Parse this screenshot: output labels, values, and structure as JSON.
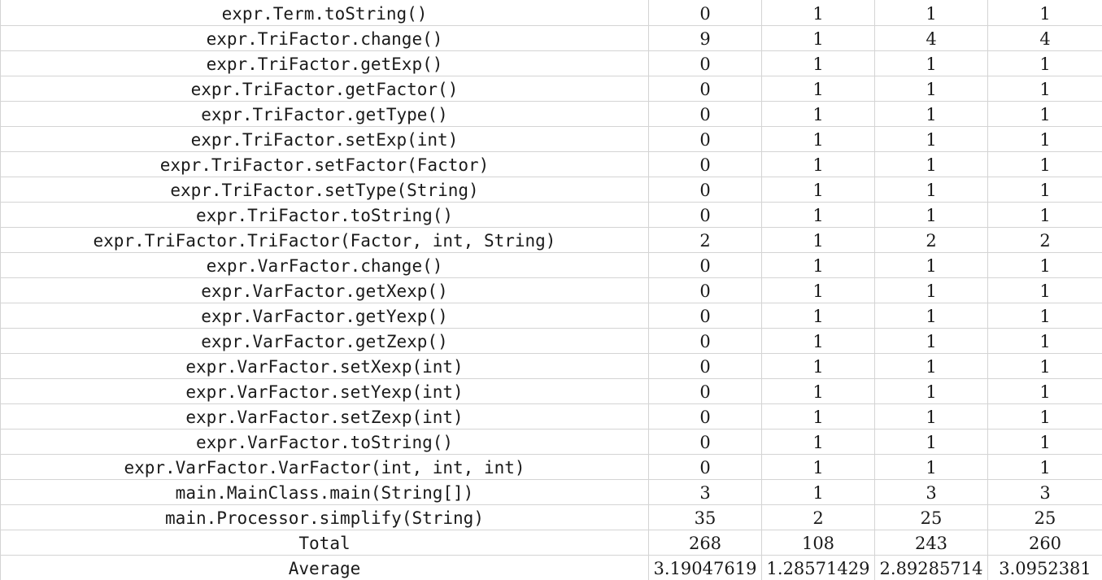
{
  "sheet": {
    "rows": [
      {
        "name": "expr.Term.toString()",
        "values": [
          "0",
          "1",
          "1",
          "1"
        ]
      },
      {
        "name": "expr.TriFactor.change()",
        "values": [
          "9",
          "1",
          "4",
          "4"
        ]
      },
      {
        "name": "expr.TriFactor.getExp()",
        "values": [
          "0",
          "1",
          "1",
          "1"
        ]
      },
      {
        "name": "expr.TriFactor.getFactor()",
        "values": [
          "0",
          "1",
          "1",
          "1"
        ]
      },
      {
        "name": "expr.TriFactor.getType()",
        "values": [
          "0",
          "1",
          "1",
          "1"
        ]
      },
      {
        "name": "expr.TriFactor.setExp(int)",
        "values": [
          "0",
          "1",
          "1",
          "1"
        ]
      },
      {
        "name": "expr.TriFactor.setFactor(Factor)",
        "values": [
          "0",
          "1",
          "1",
          "1"
        ]
      },
      {
        "name": "expr.TriFactor.setType(String)",
        "values": [
          "0",
          "1",
          "1",
          "1"
        ]
      },
      {
        "name": "expr.TriFactor.toString()",
        "values": [
          "0",
          "1",
          "1",
          "1"
        ]
      },
      {
        "name": "expr.TriFactor.TriFactor(Factor, int, String)",
        "values": [
          "2",
          "1",
          "2",
          "2"
        ]
      },
      {
        "name": "expr.VarFactor.change()",
        "values": [
          "0",
          "1",
          "1",
          "1"
        ]
      },
      {
        "name": "expr.VarFactor.getXexp()",
        "values": [
          "0",
          "1",
          "1",
          "1"
        ]
      },
      {
        "name": "expr.VarFactor.getYexp()",
        "values": [
          "0",
          "1",
          "1",
          "1"
        ]
      },
      {
        "name": "expr.VarFactor.getZexp()",
        "values": [
          "0",
          "1",
          "1",
          "1"
        ]
      },
      {
        "name": "expr.VarFactor.setXexp(int)",
        "values": [
          "0",
          "1",
          "1",
          "1"
        ]
      },
      {
        "name": "expr.VarFactor.setYexp(int)",
        "values": [
          "0",
          "1",
          "1",
          "1"
        ]
      },
      {
        "name": "expr.VarFactor.setZexp(int)",
        "values": [
          "0",
          "1",
          "1",
          "1"
        ]
      },
      {
        "name": "expr.VarFactor.toString()",
        "values": [
          "0",
          "1",
          "1",
          "1"
        ]
      },
      {
        "name": "expr.VarFactor.VarFactor(int, int, int)",
        "values": [
          "0",
          "1",
          "1",
          "1"
        ]
      },
      {
        "name": "main.MainClass.main(String[])",
        "values": [
          "3",
          "1",
          "3",
          "3"
        ]
      },
      {
        "name": "main.Processor.simplify(String)",
        "values": [
          "35",
          "2",
          "25",
          "25"
        ]
      },
      {
        "name": "Total",
        "values": [
          "268",
          "108",
          "243",
          "260"
        ]
      },
      {
        "name": "Average",
        "values": [
          "3.19047619",
          "1.28571429",
          "2.89285714",
          "3.0952381"
        ]
      }
    ]
  }
}
